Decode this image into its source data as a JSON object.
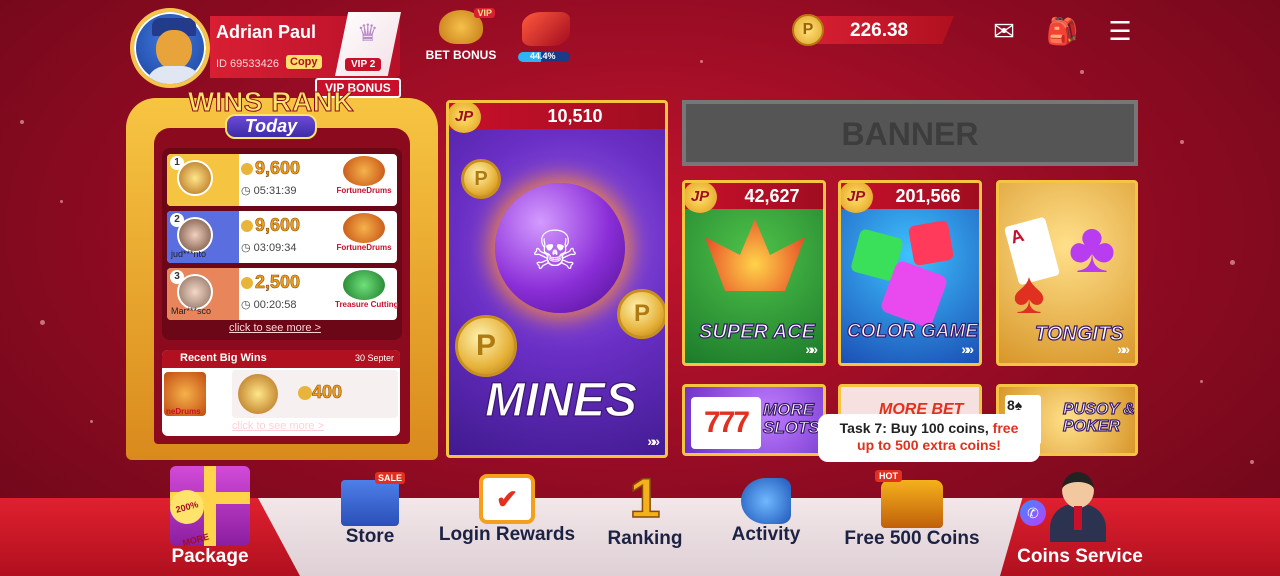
{
  "profile": {
    "name": "Adrian Paul",
    "id_text": "ID 69533426",
    "copy_label": "Copy",
    "vip_level": "VIP 2",
    "vip_bonus_label": "VIP BONUS"
  },
  "top": {
    "bet_bonus_label": "BET BONUS",
    "bet_bonus_tag": "VIP",
    "moto_progress_text": "44.4%",
    "moto_progress": 0.444,
    "coin_symbol": "P",
    "balance": "226.38",
    "icons": [
      "mail-icon",
      "backpack-icon",
      "menu-icon"
    ]
  },
  "wins_rank": {
    "title": "WINS RANK",
    "subtitle": "Today",
    "rows": [
      {
        "rank": "1",
        "user": "",
        "amount": "9,600",
        "time": "05:31:39",
        "game": "FortuneDrums",
        "band": "#f5c542"
      },
      {
        "rank": "2",
        "user": "jud***nto",
        "amount": "9,600",
        "time": "03:09:34",
        "game": "FortuneDrums",
        "band": "#5a6ee0"
      },
      {
        "rank": "3",
        "user": "Mar***sco",
        "amount": "2,500",
        "time": "00:20:58",
        "game": "Treasure Cutting",
        "band": "#e8855a"
      }
    ],
    "see_more": "click to see more >",
    "recent_title": "Recent Big Wins",
    "recent_date": "30 Septer",
    "recent_thumb_caption": "neDrums",
    "recent_win": "400",
    "recent_see_more": "click to see more >"
  },
  "games": {
    "mines": {
      "jp": "JP",
      "jackpot": "10,510",
      "name": "MINES"
    },
    "banner": "BANNER",
    "super_ace": {
      "jp": "JP",
      "jackpot": "42,627",
      "name": "SUPER ACE"
    },
    "color_game": {
      "jp": "JP",
      "jackpot": "201,566",
      "name": "COLOR GAME"
    },
    "tongits": {
      "name": "TONGITS"
    },
    "more_slots": {
      "name": "MORE SLOTS"
    },
    "more_bet": {
      "name": "MORE BET"
    },
    "pusoy": {
      "name": "PUSOY & POKER"
    }
  },
  "tooltip": {
    "part1": "Task 7: Buy 100 coins, ",
    "part2": "free",
    "part3": "up to 500 extra coins!"
  },
  "nav": {
    "package": "Package",
    "package_tag": "200% MORE",
    "store": "Store",
    "store_tag": "SALE",
    "login_rewards": "Login Rewards",
    "ranking": "Ranking",
    "ranking_glyph": "1",
    "activity": "Activity",
    "free_coins": "Free 500 Coins",
    "free_coins_tag": "HOT",
    "coins_service": "Coins Service"
  },
  "colors": {
    "background": "#a80e26",
    "accent_gold": "#f5c542",
    "accent_red": "#c8102a",
    "highlight_text": "#e0301f"
  }
}
